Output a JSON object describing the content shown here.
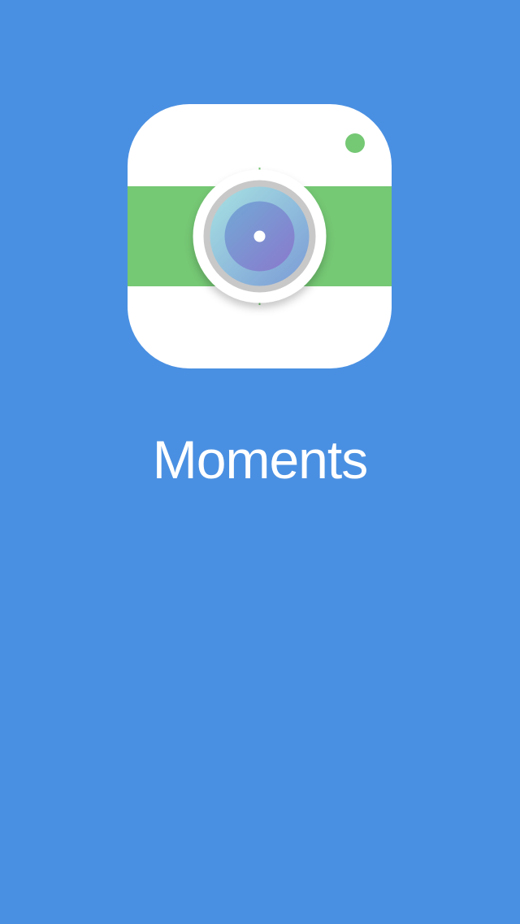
{
  "splash": {
    "app_name": "Moments",
    "icon_name": "camera-app-icon"
  },
  "colors": {
    "background": "#4a90e2",
    "icon_body": "#ffffff",
    "icon_band": "#75c874",
    "indicator_dot": "#75c874",
    "lens_ring": "#c8c8c8",
    "lens_outer": "#8fc7dc",
    "lens_inner": "#7f8dcf",
    "title_text": "#ffffff"
  }
}
